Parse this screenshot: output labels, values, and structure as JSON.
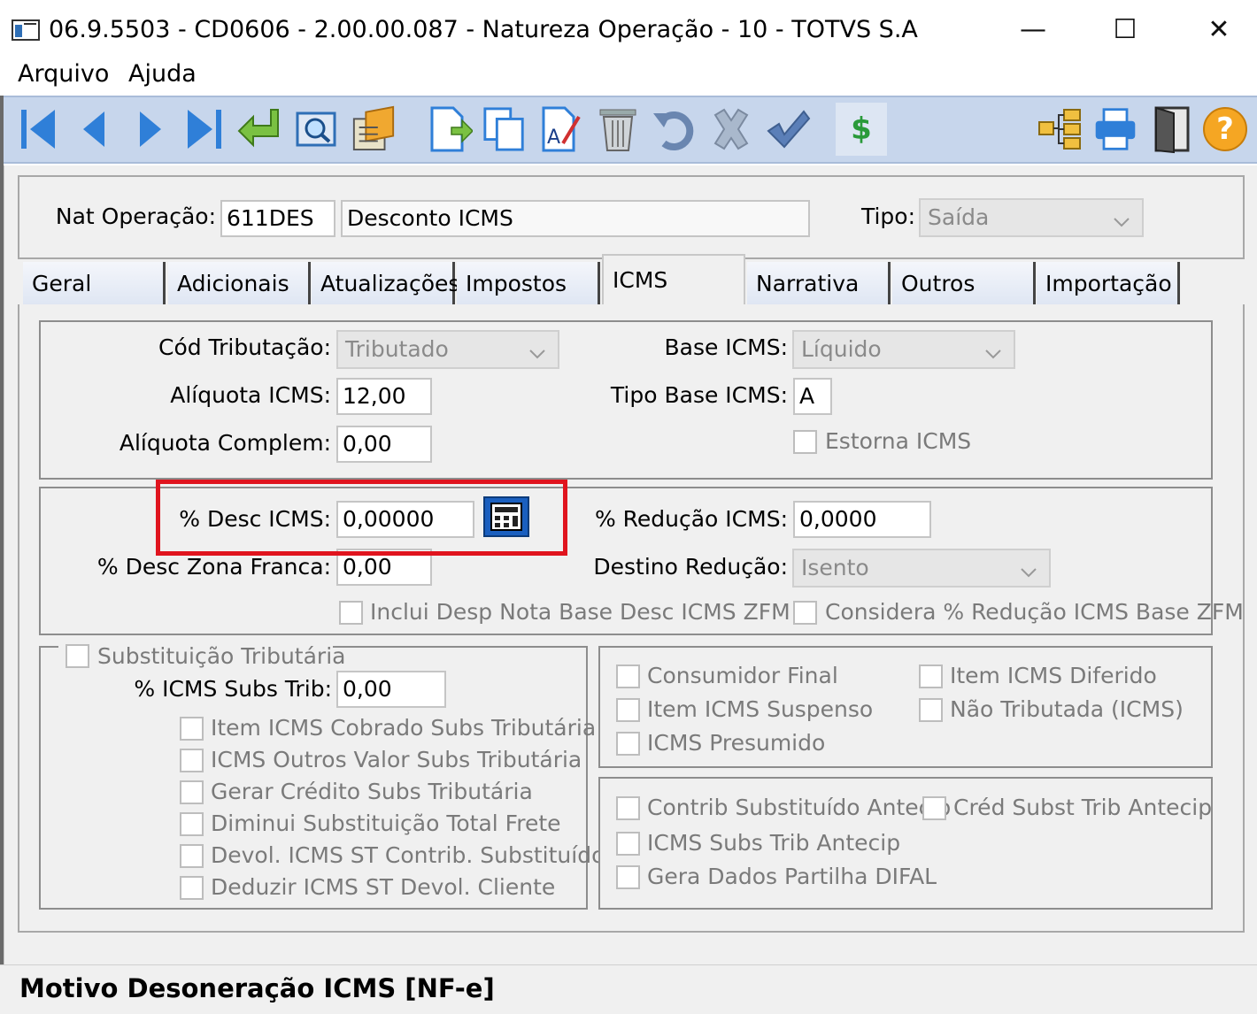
{
  "window": {
    "title": "06.9.5503 - CD0606 - 2.00.00.087 - Natureza Operação - 10 - TOTVS S.A",
    "minimize": "—",
    "maximize": "☐",
    "close": "✕"
  },
  "menu": {
    "items": [
      "Arquivo",
      "Ajuda"
    ]
  },
  "toolbar": {
    "icons": [
      "first-record-icon",
      "previous-record-icon",
      "next-record-icon",
      "last-record-icon",
      "go-to-icon",
      "search-icon",
      "zoom-icon",
      "new-record-icon",
      "copy-icon",
      "edit-icon",
      "delete-icon",
      "undo-icon",
      "cancel-icon",
      "confirm-icon",
      "currency-icon",
      "tree-icon",
      "print-icon",
      "exit-icon",
      "help-icon"
    ],
    "currency_symbol": "$",
    "help_symbol": "?"
  },
  "header": {
    "nat_label": "Nat Operação:",
    "nat_code": "611DES",
    "nat_desc": "Desconto ICMS",
    "tipo_label": "Tipo:",
    "tipo_value": "Saída"
  },
  "tabs": [
    "Geral",
    "Adicionais",
    "Atualizações",
    "Impostos",
    "ICMS",
    "Narrativa",
    "Outros",
    "Importação"
  ],
  "active_tab": "ICMS",
  "icms": {
    "cod_trib_label": "Cód Tributação:",
    "cod_trib_value": "Tributado",
    "aliquota_label": "Alíquota ICMS:",
    "aliquota_value": "12,00",
    "aliq_compl_label": "Alíquota Complem:",
    "aliq_compl_value": "0,00",
    "base_label": "Base ICMS:",
    "base_value": "Líquido",
    "tipo_base_label": "Tipo Base ICMS:",
    "tipo_base_value": "A",
    "estorna_label": "Estorna ICMS"
  },
  "desc": {
    "desc_label": "% Desc ICMS:",
    "desc_value": "0,00000",
    "zona_label": "% Desc Zona Franca:",
    "zona_value": "0,00",
    "reducao_label": "% Redução ICMS:",
    "reducao_value": "0,0000",
    "destino_label": "Destino Redução:",
    "destino_value": "Isento",
    "inclui_label": "Inclui Desp Nota Base Desc ICMS ZFM",
    "considera_label": "Considera % Redução ICMS Base ZFM"
  },
  "subst": {
    "group_label": "Substituição Tributária",
    "icms_st_label": "% ICMS Subs Trib:",
    "icms_st_value": "0,00",
    "checks": [
      "Item ICMS Cobrado Subs Tributária",
      "ICMS Outros Valor Subs Tributária",
      "Gerar Crédito Subs Tributária",
      "Diminui Substituição Total Frete",
      "Devol. ICMS ST Contrib. Substituído",
      "Deduzir ICMS ST Devol. Cliente"
    ]
  },
  "right1": {
    "consumidor": "Consumidor Final",
    "suspenso": "Item ICMS Suspenso",
    "presumido": "ICMS Presumido",
    "diferido": "Item ICMS Diferido",
    "nao_trib": "Não Tributada (ICMS)"
  },
  "right2": {
    "contrib": "Contrib Substituído Antecip",
    "subs_antecip": "ICMS Subs Trib Antecip",
    "difal": "Gera Dados Partilha DIFAL",
    "cred": "Créd Subst Trib Antecip"
  },
  "status": {
    "text": "Motivo Desoneração ICMS [NF-e]"
  },
  "colors": {
    "toolbar": "#c7d6ec",
    "highlight": "#e0141e",
    "accent": "#1a5fbf"
  }
}
